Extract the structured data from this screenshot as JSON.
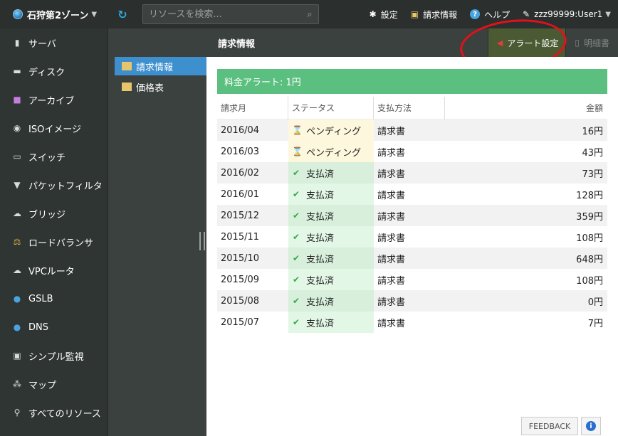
{
  "topbar": {
    "zone_label": "石狩第2ゾーン",
    "search_placeholder": "リソースを検索...",
    "settings_label": "設定",
    "billing_label": "請求情報",
    "help_label": "ヘルプ",
    "user_label": "zzz99999:User1"
  },
  "sidebar": {
    "items": [
      {
        "label": "サーバ",
        "icon": "server-icon"
      },
      {
        "label": "ディスク",
        "icon": "disk-icon"
      },
      {
        "label": "アーカイブ",
        "icon": "archive-icon"
      },
      {
        "label": "ISOイメージ",
        "icon": "iso-icon"
      },
      {
        "label": "スイッチ",
        "icon": "switch-icon"
      },
      {
        "label": "パケットフィルタ",
        "icon": "filter-icon"
      },
      {
        "label": "ブリッジ",
        "icon": "bridge-icon"
      },
      {
        "label": "ロードバランサ",
        "icon": "loadbalancer-icon"
      },
      {
        "label": "VPCルータ",
        "icon": "vpc-router-icon"
      },
      {
        "label": "GSLB",
        "icon": "gslb-icon"
      },
      {
        "label": "DNS",
        "icon": "dns-icon"
      },
      {
        "label": "シンプル監視",
        "icon": "monitor-icon"
      },
      {
        "label": "マップ",
        "icon": "map-icon"
      },
      {
        "label": "すべてのリソース",
        "icon": "all-resources-icon"
      }
    ]
  },
  "subnav": {
    "items": [
      {
        "label": "請求情報",
        "active": true
      },
      {
        "label": "価格表",
        "active": false
      }
    ]
  },
  "content": {
    "title": "請求情報",
    "alert_button": "アラート設定",
    "detail_button": "明細書",
    "banner": "料金アラート: 1円"
  },
  "table": {
    "headers": [
      "請求月",
      "ステータス",
      "支払方法",
      "金額"
    ],
    "rows": [
      {
        "month": "2016/04",
        "status": "ペンディング",
        "kind": "pending",
        "method": "請求書",
        "amount": "16円"
      },
      {
        "month": "2016/03",
        "status": "ペンディング",
        "kind": "pending",
        "method": "請求書",
        "amount": "43円"
      },
      {
        "month": "2016/02",
        "status": "支払済",
        "kind": "paid",
        "method": "請求書",
        "amount": "73円"
      },
      {
        "month": "2016/01",
        "status": "支払済",
        "kind": "paid",
        "method": "請求書",
        "amount": "128円"
      },
      {
        "month": "2015/12",
        "status": "支払済",
        "kind": "paid",
        "method": "請求書",
        "amount": "359円"
      },
      {
        "month": "2015/11",
        "status": "支払済",
        "kind": "paid",
        "method": "請求書",
        "amount": "108円"
      },
      {
        "month": "2015/10",
        "status": "支払済",
        "kind": "paid",
        "method": "請求書",
        "amount": "648円"
      },
      {
        "month": "2015/09",
        "status": "支払済",
        "kind": "paid",
        "method": "請求書",
        "amount": "108円"
      },
      {
        "month": "2015/08",
        "status": "支払済",
        "kind": "paid",
        "method": "請求書",
        "amount": "0円"
      },
      {
        "month": "2015/07",
        "status": "支払済",
        "kind": "paid",
        "method": "請求書",
        "amount": "7円"
      }
    ]
  },
  "footer": {
    "feedback_label": "FEEDBACK"
  },
  "colors": {
    "banner": "#5bbf7f",
    "active_tab": "#3d8fce",
    "annotation_ring": "#e2111a"
  }
}
